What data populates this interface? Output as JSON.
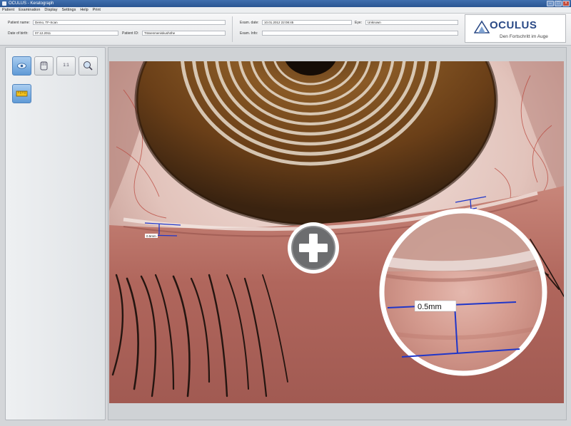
{
  "window": {
    "title": "OCULUS - Keratograph"
  },
  "menu": {
    "items": [
      "Patient",
      "Examination",
      "Display",
      "Settings",
      "Help",
      "Print"
    ]
  },
  "patient": {
    "name_label": "Patient name:",
    "name_value": "Demo, TF-Scan",
    "dob_label": "Date of birth:",
    "dob_value": "07.12.2011",
    "id_label": "Patient ID:",
    "id_value": "Tränenmeniskushöhe"
  },
  "exam": {
    "date_label": "Exam. date:",
    "date_value": "10.01.2012 22:08:45",
    "eye_label": "Eye:",
    "eye_value": "Unknown",
    "info_label": "Exam. Info:",
    "info_value": ""
  },
  "logo": {
    "brand": "OCULUS",
    "tagline": "Den Fortschritt im Auge"
  },
  "toolbar": {
    "zoom_label": "1:1"
  },
  "measurements": {
    "left_label": "0.5mm",
    "right_label": "0.5mm",
    "magnified_label": "0.5mm"
  },
  "colors": {
    "measure_line": "#1f36c9",
    "titlebar": "#2a5592",
    "brand": "#2b4a86"
  }
}
